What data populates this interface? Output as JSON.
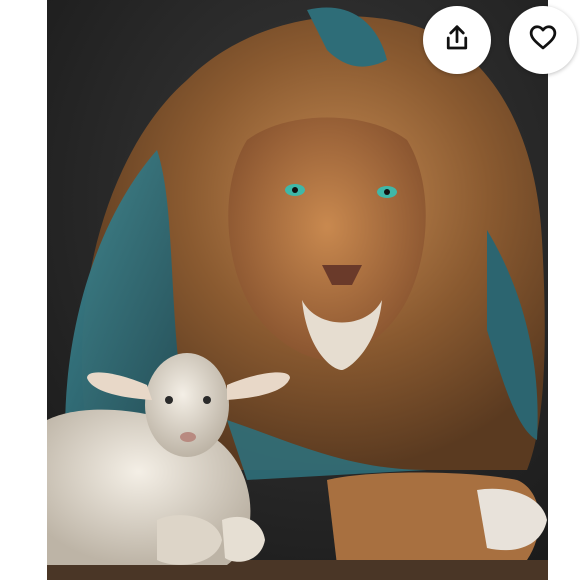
{
  "viewer": {
    "image_subject": "lion-and-lamb-painting"
  },
  "actions": {
    "share_icon": "share-upload-icon",
    "save_icon": "heart-outline-icon"
  },
  "colors": {
    "button_bg": "#ffffff",
    "icon_stroke": "#111111",
    "photo_bg": "#242424",
    "lion_mane_teal": "#2f6f78",
    "lion_mane_brown": "#9b6638"
  }
}
